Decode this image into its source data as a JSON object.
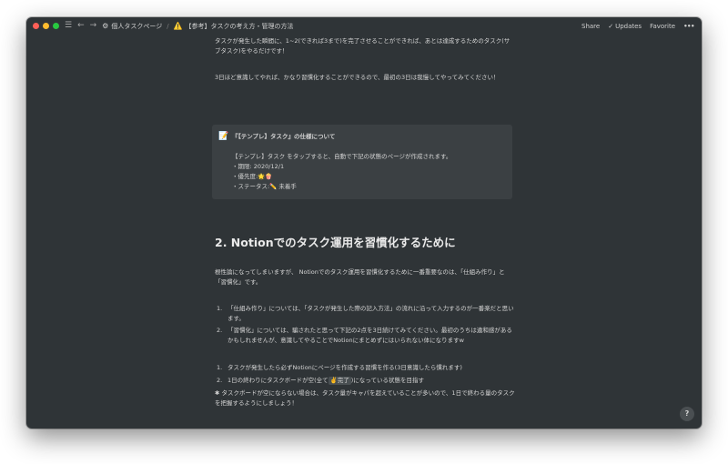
{
  "titlebar": {
    "breadcrumb_parent_icon": "⚙",
    "breadcrumb_parent": "個人タスクページ",
    "breadcrumb_sep": "/",
    "breadcrumb_current_icon": "⚠️",
    "breadcrumb_current": "【参考】タスクの考え方・管理の方法",
    "share_label": "Share",
    "updates_label": "Updates",
    "favorite_label": "Favorite",
    "more_label": "•••"
  },
  "content": {
    "p1": "タスクが発生した瞬間に、1~2(できれば3まで)を完了させることができれば、あとは達成するためのタスク(サブタスク)をやるだけです！",
    "p2": "3日ほど意識してやれば、かなり習慣化することができるので、最初の3日は我慢してやってみてください！",
    "callout": {
      "icon": "📝",
      "title": "『【テンプレ】タスク』の仕様について",
      "line1": "【テンプレ】タスク をタップすると、自動で下記の状態のページが作成されます。",
      "line2": "・期限: 2020/12/1",
      "line3_prefix": "・優先度:",
      "line3_emoji": "🌟🍿",
      "line4_prefix": "・ステータス:",
      "line4_emoji": "✏️",
      "line4_status": "未着手"
    },
    "heading": "2. Notionでのタスク運用を習慣化するために",
    "p3": "根性論になってしまいますが、 Notionでのタスク運用を習慣化するために一番重要なのは、「仕組み作り」と「習慣化」です。",
    "list1": [
      {
        "num": "1.",
        "text": "「仕組み作り」については、「タスクが発生した際の記入方法」の流れに沿って入力するのが一番楽だと思います。"
      },
      {
        "num": "2.",
        "text": "「習慣化」については、騙されたと思って下記の2点を3日続けてみてください。最初のうちは違和感があるかもしれませんが、意識してやることでNotionにまとめずにはいられない体になりますw"
      }
    ],
    "list2": [
      {
        "num": "1.",
        "text": "タスクが発生したら必ずNotionにページを作成する習慣を作る(3日意識したら慣れます)"
      }
    ],
    "list2_item2": {
      "num": "2.",
      "prefix": "1日の終わりにタスクボードが空(全て",
      "tag": "✌️完了",
      "suffix": ")になっている状態を目指す"
    },
    "note": "✱ タスクボードが空にならない場合は、タスク量がキャパを超えていることが多いので、1日で終わる量のタスクを把握するようにしましょう！"
  },
  "help_label": "?"
}
